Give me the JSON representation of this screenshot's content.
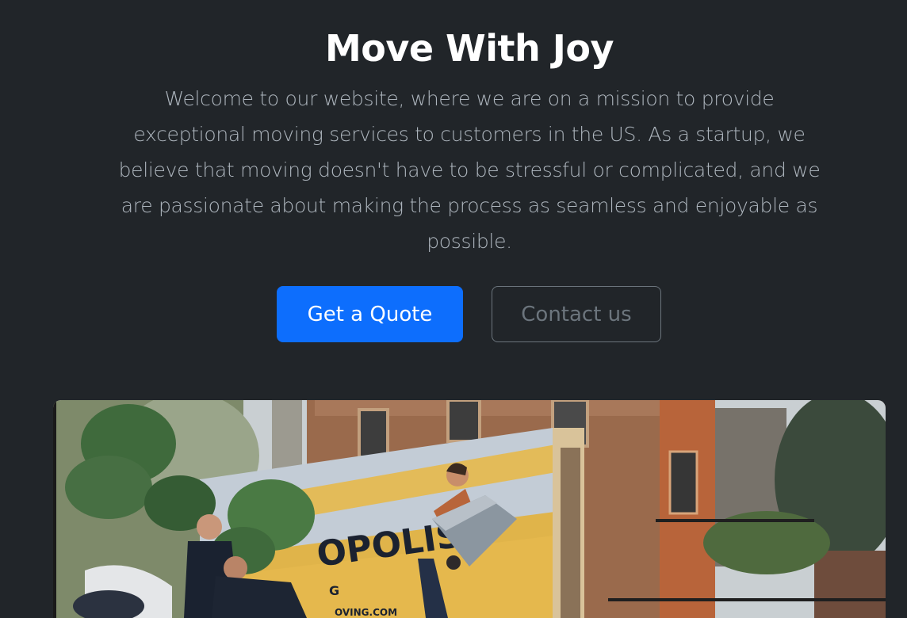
{
  "hero": {
    "title": "Move With Joy",
    "lead": "Welcome to our website, where we are on a mission to provide exceptional moving services to customers in the US. As a startup, we believe that moving doesn't have to be stressful or complicated, and we are passionate about making the process as seamless and enjoyable as possible.",
    "primary_button": "Get a Quote",
    "secondary_button": "Contact us"
  },
  "photo": {
    "truck_text": "OPOLIS",
    "truck_subtext": "OVING.COM",
    "truck_letter": "G"
  },
  "colors": {
    "background": "#212529",
    "primary": "#0d6efd",
    "muted": "#6c757d",
    "lead_text": "#adb5bd"
  }
}
